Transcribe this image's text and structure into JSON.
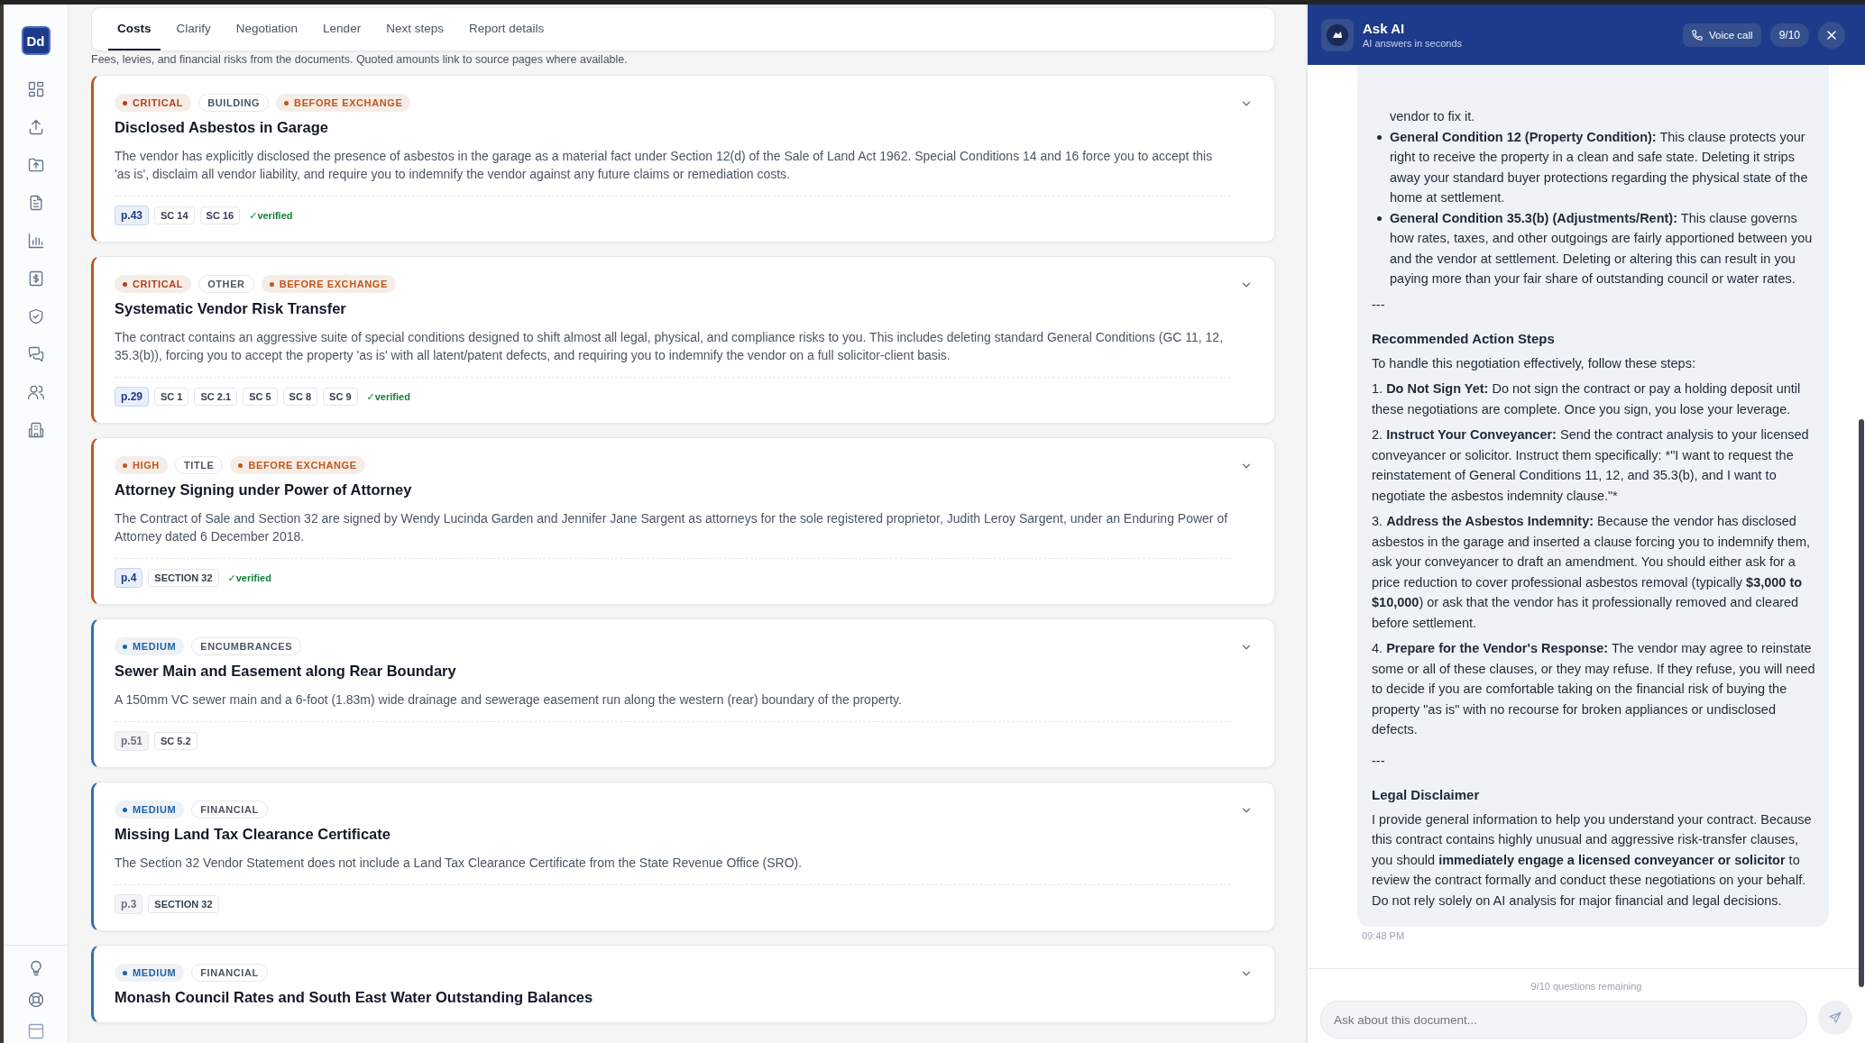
{
  "logo": "Dd",
  "tabs": [
    {
      "label": "Costs",
      "selected": true
    },
    {
      "label": "Clarify",
      "selected": false
    },
    {
      "label": "Negotiation",
      "selected": false
    },
    {
      "label": "Lender",
      "selected": false
    },
    {
      "label": "Next steps",
      "selected": false
    },
    {
      "label": "Report details",
      "selected": false
    }
  ],
  "description": "Fees, levies, and financial risks from the documents. Quoted amounts link to source pages where available.",
  "findings": [
    {
      "kind": "critical",
      "severity_label": "CRITICAL",
      "category": "BUILDING",
      "timing": "BEFORE EXCHANGE",
      "title": "Disclosed Asbestos in Garage",
      "body": "The vendor has explicitly disclosed the presence of asbestos in the garage as a material fact under Section 12(d) of the Sale of Land Act 1962. Special Conditions 14 and 16 force you to accept this 'as is', disclaim all vendor liability, and require you to indemnify the vendor against any future claims or remediation costs.",
      "page": {
        "label": "p.43",
        "verified": true
      },
      "clauses": [
        "SC 14",
        "SC 16"
      ],
      "verified_label": "✓verified"
    },
    {
      "kind": "critical",
      "severity_label": "CRITICAL",
      "category": "OTHER",
      "timing": "BEFORE EXCHANGE",
      "title": "Systematic Vendor Risk Transfer",
      "body": "The contract contains an aggressive suite of special conditions designed to shift almost all legal, physical, and compliance risks to you. This includes deleting standard General Conditions (GC 11, 12, 35.3(b)), forcing you to accept the property 'as is' with all latent/patent defects, and requiring you to indemnify the vendor on a full solicitor-client basis.",
      "page": {
        "label": "p.29",
        "verified": true
      },
      "clauses": [
        "SC 1",
        "SC 2.1",
        "SC 5",
        "SC 8",
        "SC 9"
      ],
      "verified_label": "✓verified"
    },
    {
      "kind": "high",
      "severity_label": "HIGH",
      "category": "TITLE",
      "timing": "BEFORE EXCHANGE",
      "title": "Attorney Signing under Power of Attorney",
      "body": "The Contract of Sale and Section 32 are signed by Wendy Lucinda Garden and Jennifer Jane Sargent as attorneys for the sole registered proprietor, Judith Leroy Sargent, under an Enduring Power of Attorney dated 6 December 2018.",
      "page": {
        "label": "p.4",
        "verified": true
      },
      "clauses": [
        "SECTION 32"
      ],
      "verified_label": "✓verified"
    },
    {
      "kind": "medium",
      "severity_label": "MEDIUM",
      "category": "ENCUMBRANCES",
      "title": "Sewer Main and Easement along Rear Boundary",
      "body": "A 150mm VC sewer main and a 6-foot (1.83m) wide drainage and sewerage easement run along the western (rear) boundary of the property.",
      "page": {
        "label": "p.51",
        "verified": false
      },
      "clauses": [
        "SC 5.2"
      ]
    },
    {
      "kind": "medium",
      "severity_label": "MEDIUM",
      "category": "FINANCIAL",
      "title": "Missing Land Tax Clearance Certificate",
      "body": "The Section 32 Vendor Statement does not include a Land Tax Clearance Certificate from the State Revenue Office (SRO).",
      "page": {
        "label": "p.3",
        "verified": false
      },
      "clauses": [
        "SECTION 32"
      ]
    },
    {
      "kind": "medium",
      "severity_label": "MEDIUM",
      "category": "FINANCIAL",
      "title": "Monash Council Rates and South East Water Outstanding Balances"
    }
  ],
  "chat": {
    "title": "Ask AI",
    "subtitle": "AI answers in seconds",
    "voice_button": "Voice call",
    "counter": "9/10",
    "blocks": [
      {
        "kind": "continuation",
        "text": "vendor to fix it."
      },
      {
        "kind": "bullet",
        "text": "**General Condition 12 (Property Condition):** This clause protects your right to receive the property in a clean and safe state. Deleting it strips away your standard buyer protections regarding the physical state of the home at settlement."
      },
      {
        "kind": "bullet",
        "text": "**General Condition 35.3(b) (Adjustments/Rent):** This clause governs how rates, taxes, and other outgoings are fairly apportioned between you and the vendor at settlement. Deleting or altering this can result in you paying more than your fair share of outstanding council or water rates."
      },
      {
        "kind": "rule",
        "text": "---"
      },
      {
        "kind": "heading",
        "text": "Recommended Action Steps"
      },
      {
        "kind": "para",
        "text": "To handle this negotiation effectively, follow these steps:"
      },
      {
        "kind": "para",
        "text": "1. **Do Not Sign Yet:** Do not sign the contract or pay a holding deposit until these negotiations are complete. Once you sign, you lose your leverage."
      },
      {
        "kind": "para",
        "text": "2. **Instruct Your Conveyancer:** Send the contract analysis to your licensed conveyancer or solicitor. Instruct them specifically: ",
        "plain": "*\"I want to request the reinstatement of General Conditions 11, 12, and 35.3(b), and I want to negotiate the asbestos indemnity clause.\"*"
      },
      {
        "kind": "para",
        "text": "3. **Address the Asbestos Indemnity:** Because the vendor has disclosed asbestos in the garage and inserted a clause forcing you to indemnify them, ask your conveyancer to draft an amendment. You should either ask for a price reduction to cover professional asbestos removal (typically **$3,000 to $10,000**) or ask that the vendor has it professionally removed and cleared before settlement."
      },
      {
        "kind": "para",
        "text": "4. **Prepare for the Vendor's Response:** The vendor may agree to reinstate some or all of these clauses, or they may refuse. If they refuse, you will need to decide if you are comfortable taking on the financial risk of buying the property \"as is\" with no recourse for broken appliances or undisclosed defects."
      },
      {
        "kind": "rule",
        "text": "---"
      },
      {
        "kind": "heading",
        "text": "Legal Disclaimer"
      },
      {
        "kind": "para",
        "text": "I provide general information to help you understand your contract. Because this contract contains highly unusual and aggressive risk-transfer clauses, you should **immediately engage a licensed conveyancer or solicitor** to review the contract formally and conduct these negotiations on your behalf. Do not rely solely on AI analysis for major financial and legal decisions."
      }
    ],
    "time": "09:48 PM",
    "remaining": "9/10 questions remaining",
    "input_placeholder": "Ask about this document..."
  }
}
